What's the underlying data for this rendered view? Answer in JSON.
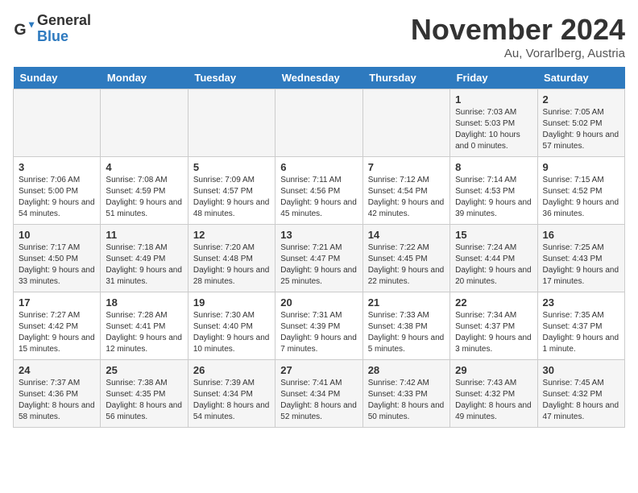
{
  "logo": {
    "general": "General",
    "blue": "Blue"
  },
  "header": {
    "month": "November 2024",
    "location": "Au, Vorarlberg, Austria"
  },
  "weekdays": [
    "Sunday",
    "Monday",
    "Tuesday",
    "Wednesday",
    "Thursday",
    "Friday",
    "Saturday"
  ],
  "weeks": [
    [
      {
        "day": "",
        "detail": ""
      },
      {
        "day": "",
        "detail": ""
      },
      {
        "day": "",
        "detail": ""
      },
      {
        "day": "",
        "detail": ""
      },
      {
        "day": "",
        "detail": ""
      },
      {
        "day": "1",
        "detail": "Sunrise: 7:03 AM\nSunset: 5:03 PM\nDaylight: 10 hours and 0 minutes."
      },
      {
        "day": "2",
        "detail": "Sunrise: 7:05 AM\nSunset: 5:02 PM\nDaylight: 9 hours and 57 minutes."
      }
    ],
    [
      {
        "day": "3",
        "detail": "Sunrise: 7:06 AM\nSunset: 5:00 PM\nDaylight: 9 hours and 54 minutes."
      },
      {
        "day": "4",
        "detail": "Sunrise: 7:08 AM\nSunset: 4:59 PM\nDaylight: 9 hours and 51 minutes."
      },
      {
        "day": "5",
        "detail": "Sunrise: 7:09 AM\nSunset: 4:57 PM\nDaylight: 9 hours and 48 minutes."
      },
      {
        "day": "6",
        "detail": "Sunrise: 7:11 AM\nSunset: 4:56 PM\nDaylight: 9 hours and 45 minutes."
      },
      {
        "day": "7",
        "detail": "Sunrise: 7:12 AM\nSunset: 4:54 PM\nDaylight: 9 hours and 42 minutes."
      },
      {
        "day": "8",
        "detail": "Sunrise: 7:14 AM\nSunset: 4:53 PM\nDaylight: 9 hours and 39 minutes."
      },
      {
        "day": "9",
        "detail": "Sunrise: 7:15 AM\nSunset: 4:52 PM\nDaylight: 9 hours and 36 minutes."
      }
    ],
    [
      {
        "day": "10",
        "detail": "Sunrise: 7:17 AM\nSunset: 4:50 PM\nDaylight: 9 hours and 33 minutes."
      },
      {
        "day": "11",
        "detail": "Sunrise: 7:18 AM\nSunset: 4:49 PM\nDaylight: 9 hours and 31 minutes."
      },
      {
        "day": "12",
        "detail": "Sunrise: 7:20 AM\nSunset: 4:48 PM\nDaylight: 9 hours and 28 minutes."
      },
      {
        "day": "13",
        "detail": "Sunrise: 7:21 AM\nSunset: 4:47 PM\nDaylight: 9 hours and 25 minutes."
      },
      {
        "day": "14",
        "detail": "Sunrise: 7:22 AM\nSunset: 4:45 PM\nDaylight: 9 hours and 22 minutes."
      },
      {
        "day": "15",
        "detail": "Sunrise: 7:24 AM\nSunset: 4:44 PM\nDaylight: 9 hours and 20 minutes."
      },
      {
        "day": "16",
        "detail": "Sunrise: 7:25 AM\nSunset: 4:43 PM\nDaylight: 9 hours and 17 minutes."
      }
    ],
    [
      {
        "day": "17",
        "detail": "Sunrise: 7:27 AM\nSunset: 4:42 PM\nDaylight: 9 hours and 15 minutes."
      },
      {
        "day": "18",
        "detail": "Sunrise: 7:28 AM\nSunset: 4:41 PM\nDaylight: 9 hours and 12 minutes."
      },
      {
        "day": "19",
        "detail": "Sunrise: 7:30 AM\nSunset: 4:40 PM\nDaylight: 9 hours and 10 minutes."
      },
      {
        "day": "20",
        "detail": "Sunrise: 7:31 AM\nSunset: 4:39 PM\nDaylight: 9 hours and 7 minutes."
      },
      {
        "day": "21",
        "detail": "Sunrise: 7:33 AM\nSunset: 4:38 PM\nDaylight: 9 hours and 5 minutes."
      },
      {
        "day": "22",
        "detail": "Sunrise: 7:34 AM\nSunset: 4:37 PM\nDaylight: 9 hours and 3 minutes."
      },
      {
        "day": "23",
        "detail": "Sunrise: 7:35 AM\nSunset: 4:37 PM\nDaylight: 9 hours and 1 minute."
      }
    ],
    [
      {
        "day": "24",
        "detail": "Sunrise: 7:37 AM\nSunset: 4:36 PM\nDaylight: 8 hours and 58 minutes."
      },
      {
        "day": "25",
        "detail": "Sunrise: 7:38 AM\nSunset: 4:35 PM\nDaylight: 8 hours and 56 minutes."
      },
      {
        "day": "26",
        "detail": "Sunrise: 7:39 AM\nSunset: 4:34 PM\nDaylight: 8 hours and 54 minutes."
      },
      {
        "day": "27",
        "detail": "Sunrise: 7:41 AM\nSunset: 4:34 PM\nDaylight: 8 hours and 52 minutes."
      },
      {
        "day": "28",
        "detail": "Sunrise: 7:42 AM\nSunset: 4:33 PM\nDaylight: 8 hours and 50 minutes."
      },
      {
        "day": "29",
        "detail": "Sunrise: 7:43 AM\nSunset: 4:32 PM\nDaylight: 8 hours and 49 minutes."
      },
      {
        "day": "30",
        "detail": "Sunrise: 7:45 AM\nSunset: 4:32 PM\nDaylight: 8 hours and 47 minutes."
      }
    ]
  ]
}
